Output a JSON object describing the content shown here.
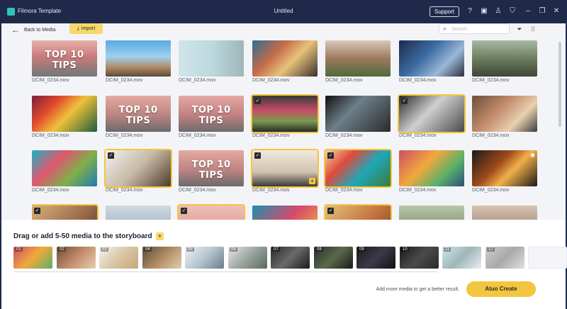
{
  "window": {
    "app_title": "Filmora Template",
    "doc_title": "Untitled",
    "support_label": "Support",
    "icons": [
      "help-icon",
      "save-icon",
      "user-icon",
      "shirt-icon",
      "minimize-icon",
      "restore-icon",
      "close-icon"
    ]
  },
  "toolbar": {
    "back_label": "Back to Media",
    "import_label": "import",
    "search_placeholder": "Search"
  },
  "media": [
    {
      "name": "DCIM_0234.mov",
      "caption": "TOP 10 TIPS",
      "selected": false
    },
    {
      "name": "DCIM_0234.mov",
      "caption": "",
      "selected": false
    },
    {
      "name": "DCIM_0234.mov",
      "caption": "",
      "selected": false
    },
    {
      "name": "DCIM_0234.mov",
      "caption": "",
      "selected": false
    },
    {
      "name": "DCIM_0234.mov",
      "caption": "",
      "selected": false
    },
    {
      "name": "DCIM_0234.mov",
      "caption": "",
      "selected": false
    },
    {
      "name": "DCIM_0234.mov",
      "caption": "",
      "selected": false
    },
    {
      "name": "DCIM_0234.mov",
      "caption": "",
      "selected": false
    },
    {
      "name": "DCIM_0234.mov",
      "caption": "TOP 10 TIPS",
      "selected": false
    },
    {
      "name": "DCIM_0234.mov",
      "caption": "TOP 10 TIPS",
      "selected": false
    },
    {
      "name": "DCIM_0234.mov",
      "caption": "",
      "selected": true
    },
    {
      "name": "DCIM_0234.mov",
      "caption": "",
      "selected": false
    },
    {
      "name": "DCIM_0234.mov",
      "caption": "",
      "selected": true
    },
    {
      "name": "DCIM_0234.mov",
      "caption": "",
      "selected": false
    },
    {
      "name": "DCIM_0234.mov",
      "caption": "",
      "selected": false
    },
    {
      "name": "DCIM_0234.mov",
      "caption": "",
      "selected": true
    },
    {
      "name": "DCIM_0234.mov",
      "caption": "TOP 10 TIPS",
      "selected": false
    },
    {
      "name": "DCIM_0234.mov",
      "caption": "",
      "selected": true
    },
    {
      "name": "DCIM_0234.mov",
      "caption": "",
      "selected": true
    },
    {
      "name": "DCIM_0234.mov",
      "caption": "",
      "selected": false
    },
    {
      "name": "DCIM_0234.mov",
      "caption": "",
      "selected": false
    },
    {
      "name": "",
      "caption": "",
      "selected": true
    },
    {
      "name": "",
      "caption": "",
      "selected": false
    },
    {
      "name": "",
      "caption": "",
      "selected": true
    },
    {
      "name": "",
      "caption": "",
      "selected": false
    },
    {
      "name": "",
      "caption": "",
      "selected": true
    },
    {
      "name": "",
      "caption": "",
      "selected": false
    },
    {
      "name": "",
      "caption": "",
      "selected": false
    }
  ],
  "storyboard": {
    "title": "Drag or add 5-50 media to the storyboard",
    "slots": [
      "01",
      "02",
      "03",
      "04",
      "05",
      "06",
      "07",
      "08",
      "09",
      "10",
      "11",
      "12",
      ""
    ],
    "hint": "Add more media to get a better result.",
    "create_label": "Atuo Create"
  },
  "colors": {
    "accent": "#f3c640",
    "titlebar": "#1f2a4a",
    "panel": "#f3f4f7"
  }
}
